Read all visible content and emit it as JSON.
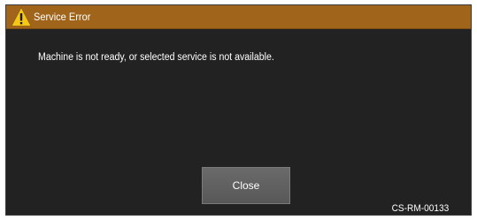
{
  "dialog": {
    "title": "Service Error",
    "title_icon": "warning-icon",
    "message": "Machine is not ready, or selected service is not available.",
    "close_label": "Close",
    "error_code": "CS-RM-00133"
  },
  "colors": {
    "title_bar": "#a0651b",
    "background": "#222222",
    "button": "#606060",
    "text": "#ffffff",
    "warning_fill": "#f5c518"
  }
}
